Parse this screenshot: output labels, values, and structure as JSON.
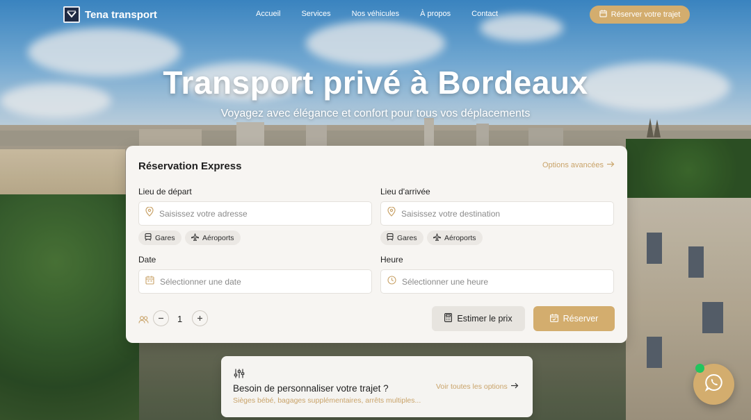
{
  "brand": {
    "name": "Tena transport"
  },
  "nav": {
    "links": [
      "Accueil",
      "Services",
      "Nos véhicules",
      "À propos",
      "Contact"
    ],
    "cta": "Réserver votre trajet"
  },
  "hero": {
    "title": "Transport privé à Bordeaux",
    "subtitle": "Voyagez avec élégance et confort pour tous vos déplacements"
  },
  "booking": {
    "title": "Réservation Express",
    "advanced_link": "Options avancées",
    "departure": {
      "label": "Lieu de départ",
      "placeholder": "Saisissez votre adresse",
      "chips": [
        "Gares",
        "Aéroports"
      ]
    },
    "arrival": {
      "label": "Lieu d'arrivée",
      "placeholder": "Saisissez votre destination",
      "chips": [
        "Gares",
        "Aéroports"
      ]
    },
    "date": {
      "label": "Date",
      "placeholder": "Sélectionner une date"
    },
    "time": {
      "label": "Heure",
      "placeholder": "Sélectionner une heure"
    },
    "passengers": {
      "count": "1"
    },
    "estimate_button": "Estimer le prix",
    "reserve_button": "Réserver"
  },
  "custom": {
    "title": "Besoin de personnaliser votre trajet ?",
    "subtitle": "Sièges bébé, bagages supplémentaires, arrêts multiples...",
    "link": "Voir toutes les options"
  },
  "colors": {
    "accent": "#d3ad6e",
    "accent_text": "#c9a369",
    "card_bg": "#f7f5f2",
    "online_dot": "#22c55e"
  },
  "icons": {
    "logo": "logo-icon",
    "calendar": "calendar-icon",
    "pin": "map-pin-icon",
    "train": "train-icon",
    "plane": "plane-icon",
    "clock": "clock-icon",
    "users": "users-icon",
    "calculator": "calculator-icon",
    "sliders": "sliders-icon",
    "arrow": "arrow-right-icon",
    "whatsapp": "whatsapp-icon"
  }
}
